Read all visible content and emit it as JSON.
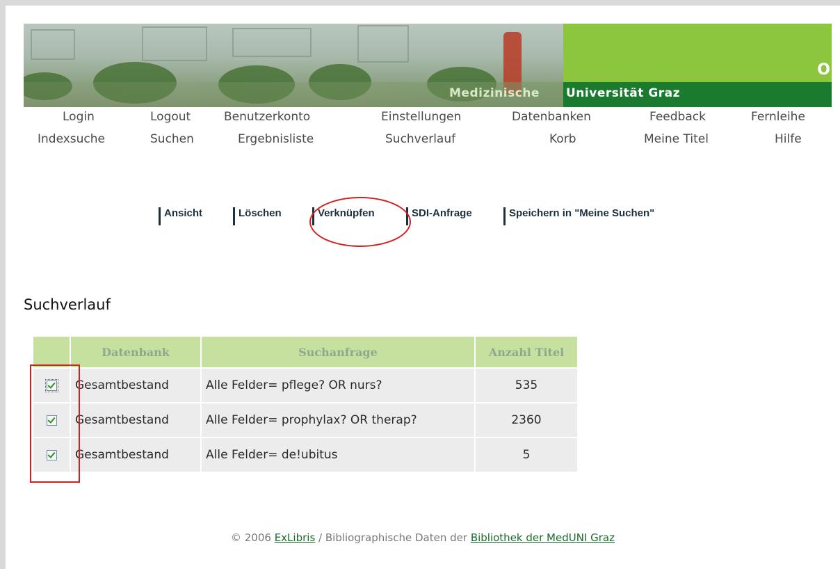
{
  "banner": {
    "subtitle_part1": "Medizinische",
    "subtitle_part2": "Universität Graz",
    "cut_letter": "O",
    "colors": {
      "light_green": "#8cc63f",
      "dark_green": "#1a7a2e"
    }
  },
  "nav": {
    "row1": [
      "Login",
      "Logout",
      "Benutzerkonto",
      "Einstellungen",
      "Datenbanken",
      "Feedback",
      "Fernleihe"
    ],
    "row2": [
      "Indexsuche",
      "Suchen",
      "Ergebnisliste",
      "Suchverlauf",
      "Korb",
      "Meine Titel",
      "Hilfe"
    ]
  },
  "actions": [
    "Ansicht",
    "Löschen",
    "Verknüpfen",
    "SDI-Anfrage",
    "Speichern in \"Meine Suchen\""
  ],
  "page_title": "Suchverlauf",
  "table": {
    "headers": [
      "Datenbank",
      "Suchanfrage",
      "Anzahl Titel"
    ],
    "rows": [
      {
        "checked": true,
        "datenbank": "Gesamtbestand",
        "suchanfrage": "Alle Felder= pflege? OR nurs?",
        "anzahl": "535"
      },
      {
        "checked": true,
        "datenbank": "Gesamtbestand",
        "suchanfrage": "Alle Felder= prophylax? OR therap?",
        "anzahl": "2360"
      },
      {
        "checked": true,
        "datenbank": "Gesamtbestand",
        "suchanfrage": "Alle Felder= de!ubitus",
        "anzahl": "5"
      }
    ]
  },
  "footer": {
    "prefix": "© 2006 ",
    "exlibris": "ExLibris",
    "middle": " / Bibliographische Daten der ",
    "library": "Bibliothek der MedUNI Graz"
  },
  "annotation_color": "#d21f1f"
}
